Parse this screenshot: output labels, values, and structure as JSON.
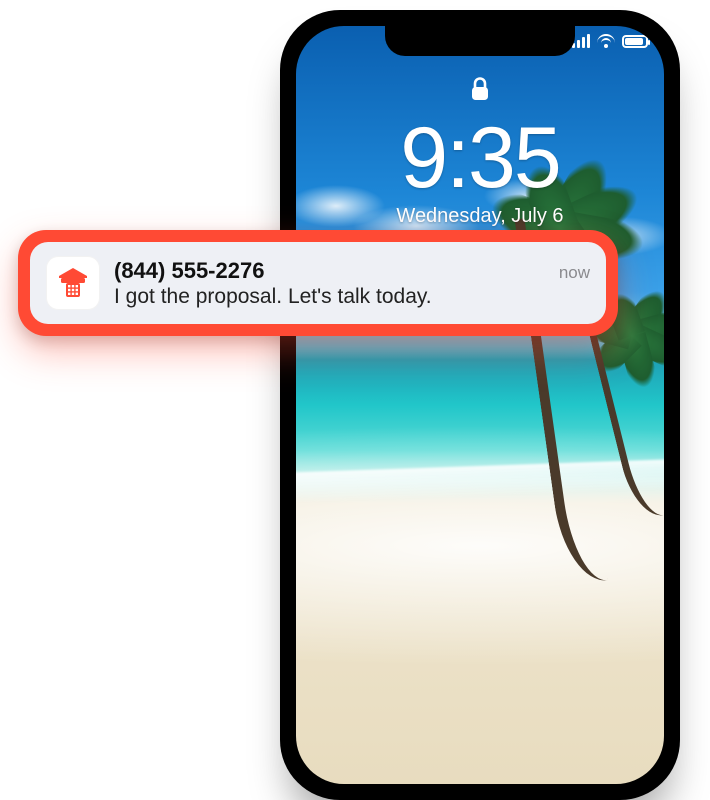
{
  "lockscreen": {
    "time": "9:35",
    "date": "Wednesday, July 6"
  },
  "notification": {
    "sender": "(844) 555-2276",
    "message": "I got the proposal. Let's talk today.",
    "timestamp_label": "now",
    "app_icon_name": "phone-icon",
    "accent_color": "#ff4a34"
  }
}
